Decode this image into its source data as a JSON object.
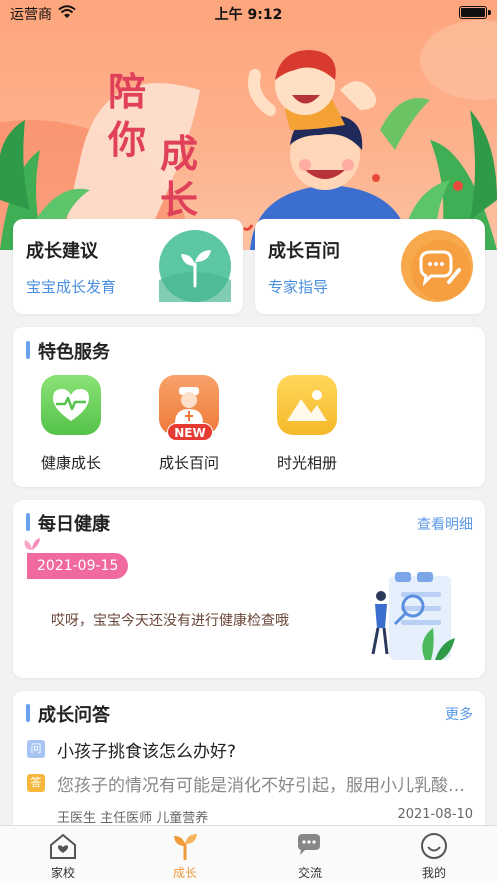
{
  "status_bar": {
    "carrier": "运营商",
    "time": "上午 9:12"
  },
  "hero": {
    "slogan_chars": [
      "陪",
      "你",
      "成",
      "长"
    ]
  },
  "quick_cards": [
    {
      "title": "成长建议",
      "subtitle": "宝宝成长发育",
      "icon": "sprout-icon",
      "color": "#5cc7a2"
    },
    {
      "title": "成长百问",
      "subtitle": "专家指导",
      "icon": "chat-pencil-icon",
      "color": "#f7a94c"
    }
  ],
  "services": {
    "title": "特色服务",
    "items": [
      {
        "label": "健康成长",
        "icon": "heart-pulse-icon",
        "color": "#67cd59"
      },
      {
        "label": "成长百问",
        "icon": "doctor-icon",
        "color": "#f28a4a",
        "badge": "NEW"
      },
      {
        "label": "时光相册",
        "icon": "mountain-photo-icon",
        "color": "#f8c33b"
      }
    ]
  },
  "daily_health": {
    "title": "每日健康",
    "link": "查看明细",
    "date": "2021-09-15",
    "message": "哎呀，宝宝今天还没有进行健康检查哦"
  },
  "qa": {
    "title": "成长问答",
    "link": "更多",
    "question_tag": "问",
    "question": "小孩子挑食该怎么办好?",
    "answer_tag": "答",
    "answer": "您孩子的情况有可能是消化不好引起，服用小儿乳酸菌...",
    "author": "王医生 主任医师 儿童营养",
    "date": "2021-08-10"
  },
  "tabs": [
    {
      "label": "家校",
      "icon": "house-heart-icon"
    },
    {
      "label": "成长",
      "icon": "sprout-icon",
      "active": true
    },
    {
      "label": "交流",
      "icon": "chat-bubbles-icon"
    },
    {
      "label": "我的",
      "icon": "smile-icon"
    }
  ],
  "colors": {
    "accent": "#f09a3a",
    "link": "#5a9ae8",
    "hero": "#fda57c"
  }
}
